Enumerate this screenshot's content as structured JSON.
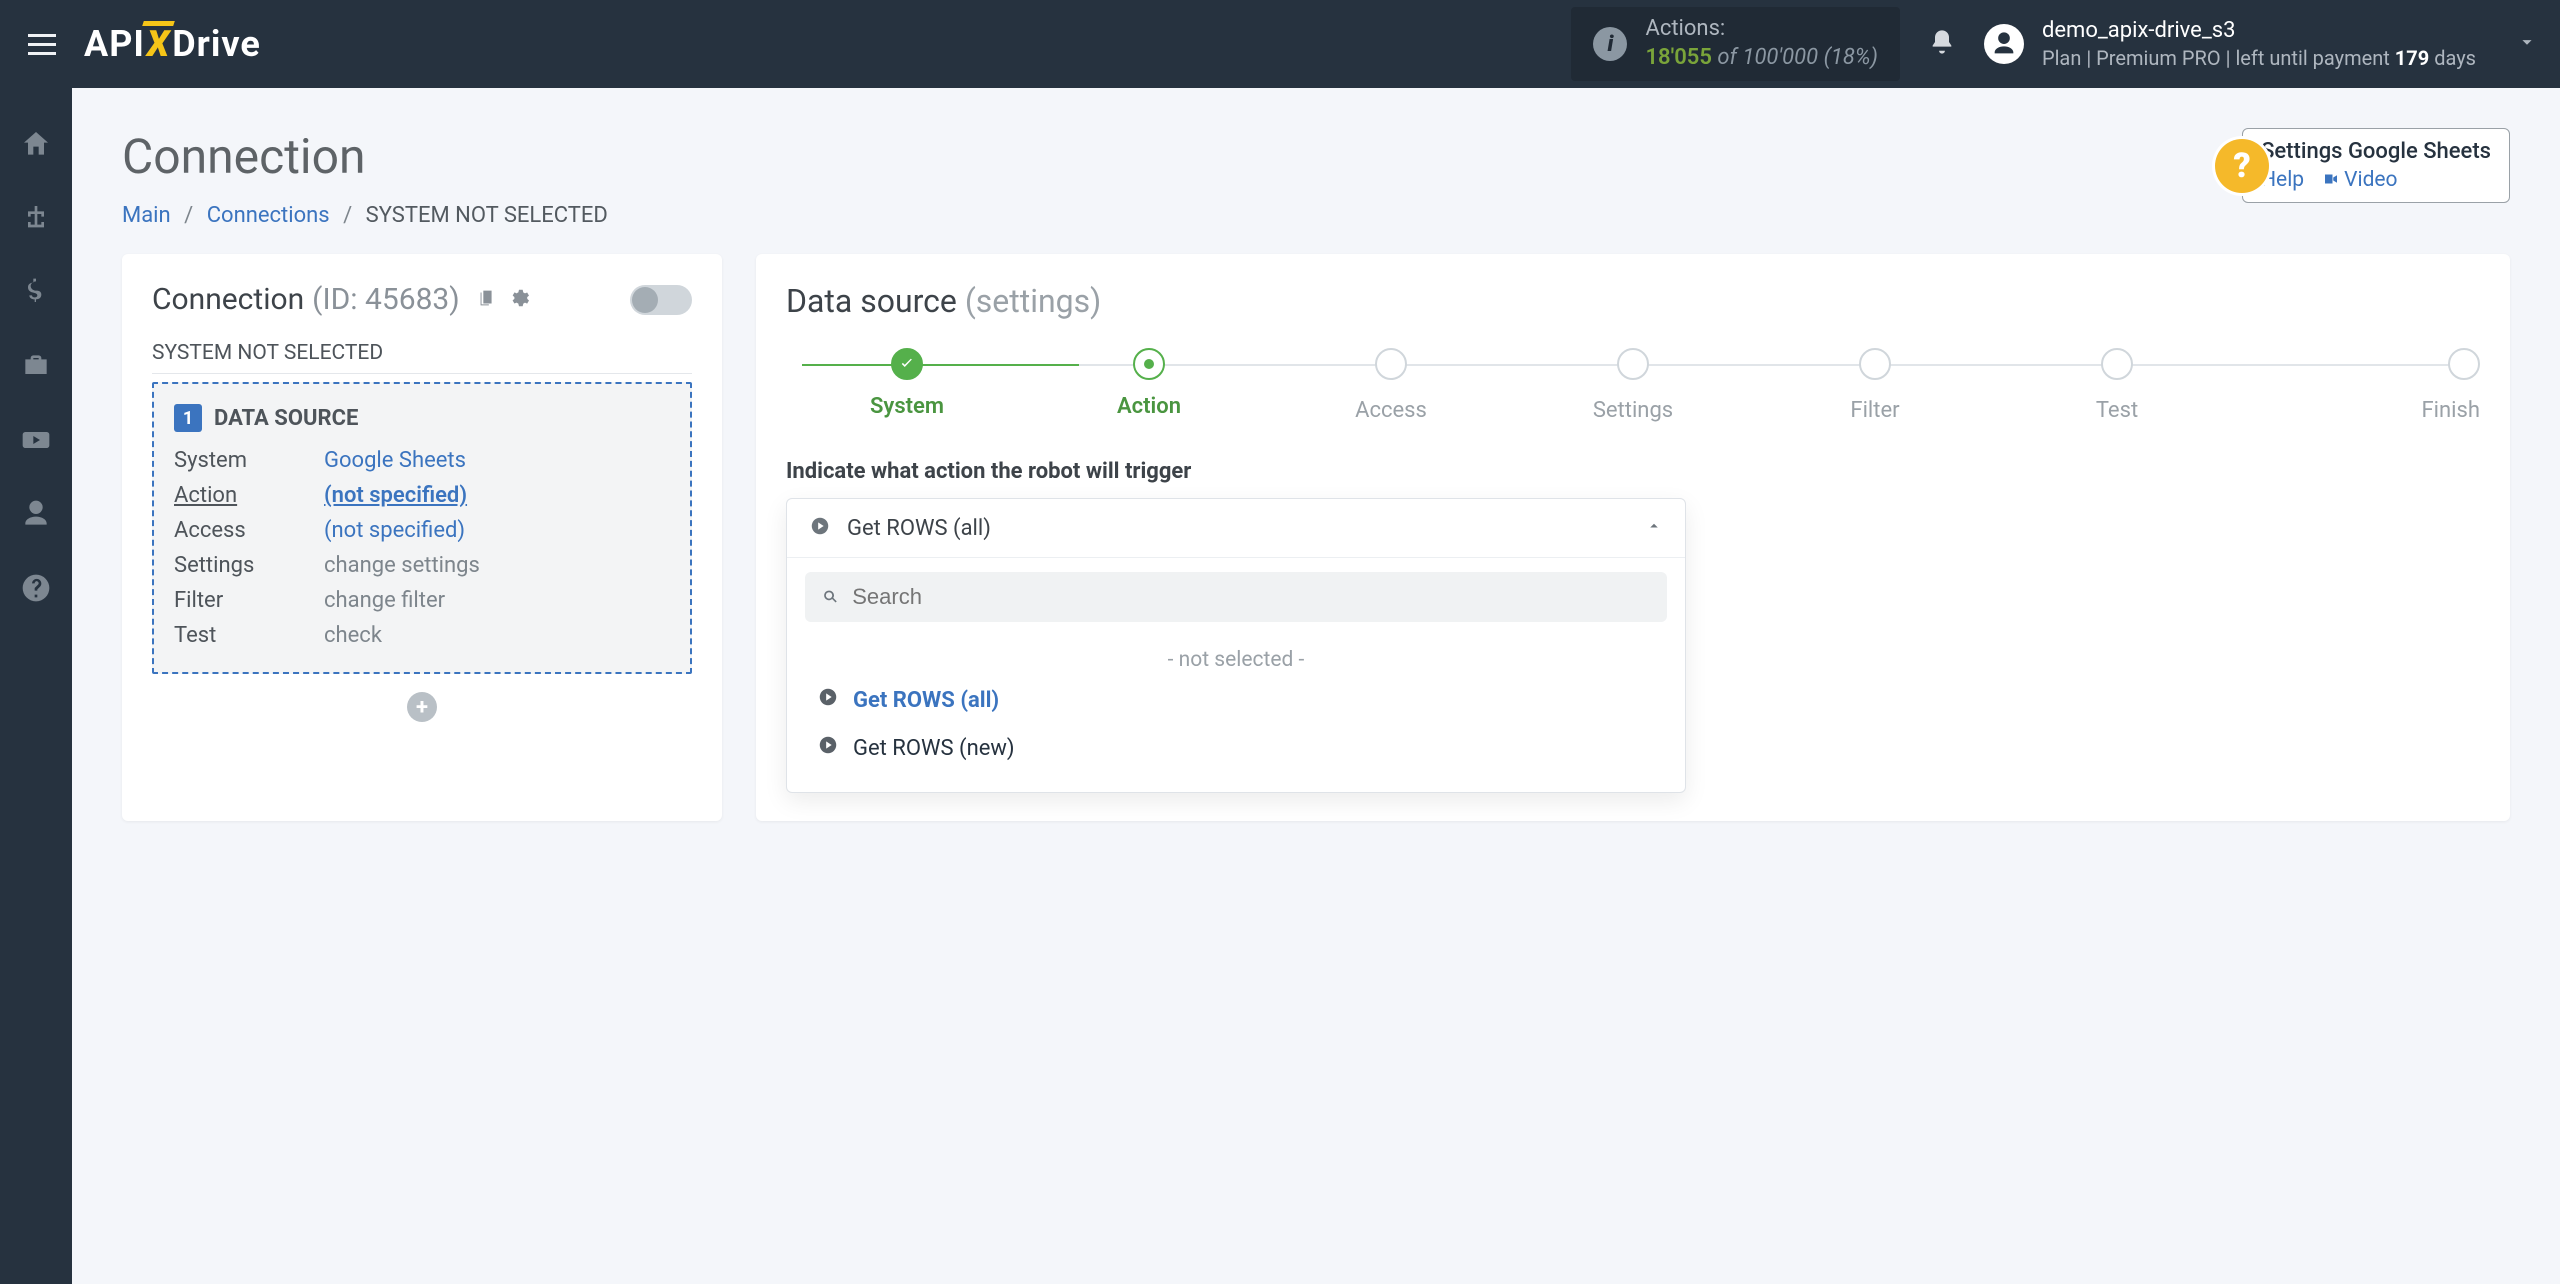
{
  "brand": {
    "part1": "API",
    "x": "X",
    "part2": "Drive"
  },
  "header": {
    "actions_label": "Actions:",
    "actions_used": "18'055",
    "actions_of": "of",
    "actions_total": "100'000",
    "actions_pct": "(18%)",
    "user_name": "demo_apix-drive_s3",
    "plan_a": "Plan |",
    "plan_b": "Premium PRO",
    "plan_c": "| left until payment ",
    "plan_days": "179",
    "plan_d": " days"
  },
  "page": {
    "title": "Connection",
    "crumb_main": "Main",
    "crumb_conn": "Connections",
    "crumb_cur": "SYSTEM NOT SELECTED"
  },
  "left": {
    "title": "Connection",
    "id_label": "(ID: 45683)",
    "subtitle": "SYSTEM NOT SELECTED",
    "badge_num": "1",
    "badge_label": "DATA SOURCE",
    "rows": {
      "system": {
        "k": "System",
        "v": "Google Sheets"
      },
      "action": {
        "k": "Action",
        "v": "(not specified)"
      },
      "access": {
        "k": "Access",
        "v": "(not specified)"
      },
      "settings": {
        "k": "Settings",
        "v": "change settings"
      },
      "filter": {
        "k": "Filter",
        "v": "change filter"
      },
      "test": {
        "k": "Test",
        "v": "check"
      }
    }
  },
  "right": {
    "title": "Data source",
    "title_suffix": "(settings)",
    "steps": [
      "System",
      "Action",
      "Access",
      "Settings",
      "Filter",
      "Test",
      "Finish"
    ],
    "instr": "Indicate what action the robot will trigger",
    "selected_value": "Get ROWS (all)",
    "search_placeholder": "Search",
    "options": {
      "empty": "- not selected -",
      "o1": "Get ROWS (all)",
      "o2": "Get ROWS (new)"
    }
  },
  "help": {
    "title": "Settings Google Sheets",
    "help": "Help",
    "video": "Video"
  }
}
